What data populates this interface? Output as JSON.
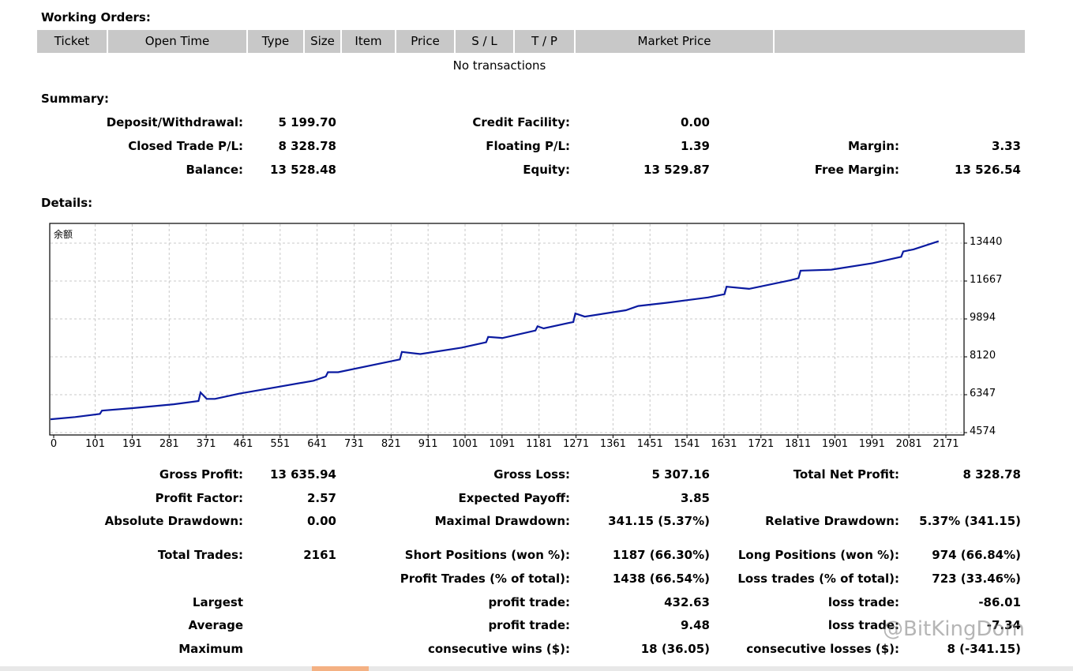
{
  "working_orders": {
    "title": "Working Orders:",
    "columns": [
      "Ticket",
      "Open Time",
      "Type",
      "Size",
      "Item",
      "Price",
      "S / L",
      "T / P",
      "Market Price",
      ""
    ],
    "empty_text": "No transactions"
  },
  "summary": {
    "title": "Summary:",
    "rows": [
      [
        {
          "label": "Deposit/Withdrawal:",
          "value": "5 199.70"
        },
        {
          "label": "Credit Facility:",
          "value": "0.00"
        },
        {
          "label": "",
          "value": ""
        }
      ],
      [
        {
          "label": "Closed Trade P/L:",
          "value": "8 328.78"
        },
        {
          "label": "Floating P/L:",
          "value": "1.39"
        },
        {
          "label": "Margin:",
          "value": "3.33"
        }
      ],
      [
        {
          "label": "Balance:",
          "value": "13 528.48"
        },
        {
          "label": "Equity:",
          "value": "13 529.87"
        },
        {
          "label": "Free Margin:",
          "value": "13 526.54"
        }
      ]
    ]
  },
  "details": {
    "title": "Details:",
    "rows": [
      [
        {
          "label": "Gross Profit:",
          "value": "13 635.94"
        },
        {
          "label": "Gross Loss:",
          "value": "5 307.16"
        },
        {
          "label": "Total Net Profit:",
          "value": "8 328.78"
        }
      ],
      [
        {
          "label": "Profit Factor:",
          "value": "2.57"
        },
        {
          "label": "Expected Payoff:",
          "value": "3.85"
        },
        {
          "label": "",
          "value": ""
        }
      ],
      [
        {
          "label": "Absolute Drawdown:",
          "value": "0.00"
        },
        {
          "label": "Maximal Drawdown:",
          "value": "341.15 (5.37%)"
        },
        {
          "label": "Relative Drawdown:",
          "value": "5.37% (341.15)"
        }
      ],
      [
        {
          "label": "Total Trades:",
          "value": "2161"
        },
        {
          "label": "Short Positions (won %):",
          "value": "1187 (66.30%)"
        },
        {
          "label": "Long Positions (won %):",
          "value": "974 (66.84%)"
        }
      ],
      [
        {
          "label": "",
          "value": ""
        },
        {
          "label": "Profit Trades (% of total):",
          "value": "1438 (66.54%)"
        },
        {
          "label": "Loss trades (% of total):",
          "value": "723 (33.46%)"
        }
      ],
      [
        {
          "label": "Largest",
          "value": ""
        },
        {
          "label": "profit trade:",
          "value": "432.63"
        },
        {
          "label": "loss trade:",
          "value": "-86.01"
        }
      ],
      [
        {
          "label": "Average",
          "value": ""
        },
        {
          "label": "profit trade:",
          "value": "9.48"
        },
        {
          "label": "loss trade:",
          "value": "-7.34"
        }
      ],
      [
        {
          "label": "Maximum",
          "value": ""
        },
        {
          "label": "consecutive wins ($):",
          "value": "18 (36.05)"
        },
        {
          "label": "consecutive losses ($):",
          "value": "8 (-341.15)"
        }
      ]
    ]
  },
  "chart_data": {
    "type": "line",
    "title": "余额",
    "line_color": "#0a1aa0",
    "x_ticks": [
      0,
      101,
      191,
      281,
      371,
      461,
      551,
      641,
      731,
      821,
      911,
      1001,
      1091,
      1181,
      1271,
      1361,
      1451,
      1541,
      1631,
      1721,
      1811,
      1901,
      1991,
      2081,
      2171
    ],
    "y_ticks": [
      4574,
      6347,
      8120,
      9894,
      11667,
      13440
    ],
    "xlim": [
      0,
      2161
    ],
    "ylim": [
      4574,
      14540
    ],
    "grid": true,
    "series": [
      {
        "name": "",
        "x": [
          0,
          60,
          120,
          125,
          200,
          300,
          360,
          365,
          380,
          400,
          460,
          550,
          640,
          670,
          675,
          700,
          800,
          850,
          855,
          900,
          1000,
          1060,
          1065,
          1100,
          1180,
          1185,
          1200,
          1260,
          1272,
          1277,
          1300,
          1400,
          1430,
          1500,
          1600,
          1640,
          1645,
          1700,
          1800,
          1820,
          1825,
          1900,
          2000,
          2070,
          2075,
          2100,
          2161
        ],
        "y": [
          5199,
          5300,
          5450,
          5600,
          5720,
          5900,
          6050,
          6450,
          6150,
          6150,
          6400,
          6700,
          7000,
          7200,
          7400,
          7400,
          7800,
          8000,
          8350,
          8250,
          8550,
          8800,
          9050,
          9000,
          9350,
          9550,
          9450,
          9700,
          9750,
          10150,
          10000,
          10300,
          10500,
          10650,
          10900,
          11050,
          11400,
          11300,
          11700,
          11800,
          12150,
          12200,
          12500,
          12800,
          13050,
          13150,
          13528
        ]
      }
    ]
  },
  "watermark": "@BitKingDom"
}
